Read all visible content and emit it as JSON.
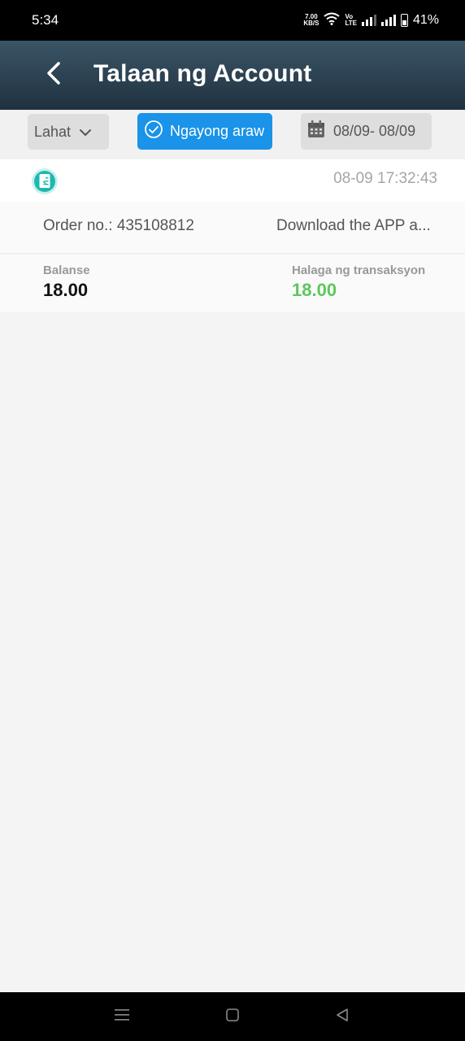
{
  "status_bar": {
    "time": "5:34",
    "net_speed_value": "7.00",
    "net_speed_unit": "KB/S",
    "volte_top": "Vo",
    "volte_bottom": "LTE",
    "battery_percent": "41%"
  },
  "header": {
    "title": "Talaan ng Account",
    "back_icon": "chevron-left-icon",
    "background": "#2b4252"
  },
  "filters": {
    "type_select": {
      "label": "Lahat",
      "icon": "chevron-down-icon"
    },
    "today_button": {
      "label": "Ngayong araw",
      "icon": "check-circle-icon",
      "color": "#1a93e8"
    },
    "date_range": {
      "label": "08/09- 08/09",
      "icon": "calendar-icon"
    }
  },
  "records": [
    {
      "icon": "receipt-icon",
      "time": "08-09 17:32:43",
      "order_no": "Order no.: 435108812",
      "description": "Download the APP a...",
      "balance_label": "Balanse",
      "balance": "18.00",
      "amount_label": "Halaga ng transaksyon",
      "amount": "18.00",
      "amount_color": "#5cc75c"
    }
  ],
  "nav_bar": {
    "menu_icon": "menu-icon",
    "home_icon": "home-square-icon",
    "back_icon": "back-triangle-icon"
  }
}
